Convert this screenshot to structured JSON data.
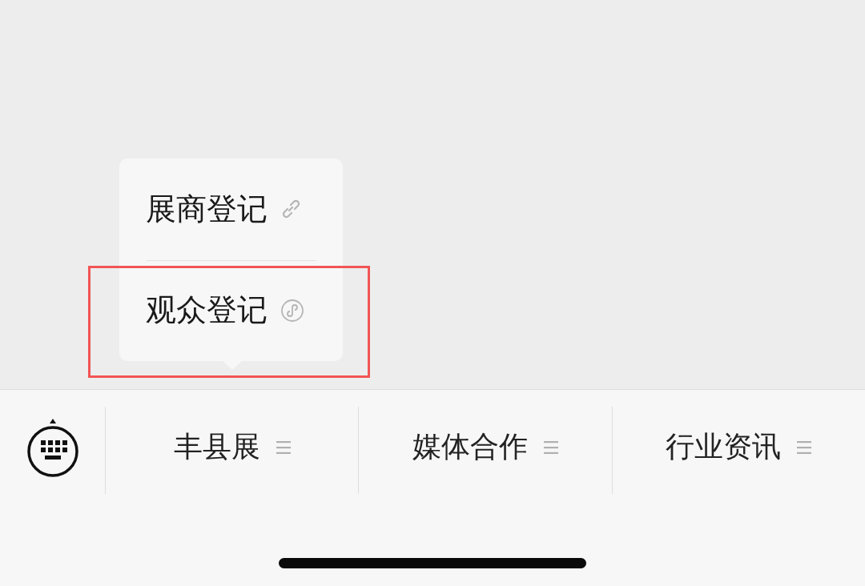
{
  "popup": {
    "items": [
      {
        "label": "展商登记",
        "kind": "link",
        "highlighted": false
      },
      {
        "label": "观众登记",
        "kind": "miniprogram",
        "highlighted": true
      }
    ]
  },
  "menu_bar": {
    "items": [
      {
        "label": "丰县展"
      },
      {
        "label": "媒体合作"
      },
      {
        "label": "行业资讯"
      }
    ]
  }
}
